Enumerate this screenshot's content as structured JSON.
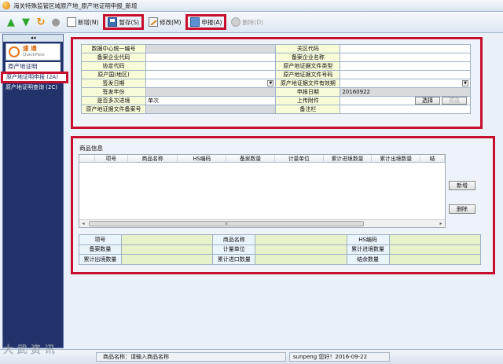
{
  "window": {
    "title": "海关特殊监管区域原产地_原产地证明申报_新增"
  },
  "toolbar": {
    "new_label": "新增(N)",
    "save_label": "暂存(S)",
    "edit_label": "修改(M)",
    "report_label": "申报(A)",
    "delete_label": "删除(D)"
  },
  "sidebar": {
    "collapse": "◂◂",
    "logo_cn": "速 通",
    "logo_en": "QuickPass",
    "group": "原产地证明",
    "items": [
      {
        "label": "原产地证明申报 (2A)"
      },
      {
        "label": "原产地证明查询 (2C)"
      }
    ]
  },
  "form": {
    "rows": [
      {
        "l1": "数据中心统一编号",
        "v1": "",
        "l2": "关区代码",
        "v2": ""
      },
      {
        "l1": "备案企业代码",
        "v1": "",
        "l2": "备案企业名称",
        "v2": ""
      },
      {
        "l1": "协定代码",
        "v1": "",
        "l2": "原产地证据文件类型",
        "v2": ""
      },
      {
        "l1": "原产国(地区)",
        "v1": "",
        "l2": "原产地证据文件号码",
        "v2": ""
      },
      {
        "l1": "签发日期",
        "v1": "",
        "l2": "原产地证据文件有效期",
        "v2": ""
      },
      {
        "l1": "签发年份",
        "v1": "",
        "l2": "申报日期",
        "v2": "20160922"
      },
      {
        "l1": "是否多次进境",
        "v1": "单次",
        "l2": "上传附件",
        "v2": ""
      },
      {
        "l1": "原产地证据文件备案号",
        "v1": "",
        "l2": "备注栏",
        "v2": ""
      }
    ],
    "select_label": "选择",
    "preview_label": "预览"
  },
  "goods": {
    "title": "商品信息",
    "columns": [
      "项号",
      "商品名称",
      "HS编码",
      "备案数量",
      "计量单位",
      "累计进境数量",
      "累计出境数量",
      "结"
    ],
    "add_label": "新增",
    "delete_label": "删除",
    "scroll_thumb": "≡",
    "scroll_left": "◂",
    "scroll_right": "▸"
  },
  "detail": {
    "rows": [
      [
        "项号",
        "",
        "商品名称",
        "",
        "HS编码",
        ""
      ],
      [
        "备案数量",
        "",
        "计量单位",
        "",
        "累计进境数量",
        ""
      ],
      [
        "累计出境数量",
        "",
        "累计进口数量",
        "",
        "结余数量",
        ""
      ]
    ]
  },
  "status": {
    "prompt": "商品名称：请输入商品名称",
    "user": "sunpeng  您好！2016-09-22"
  },
  "watermark": "大 武 资 讯"
}
